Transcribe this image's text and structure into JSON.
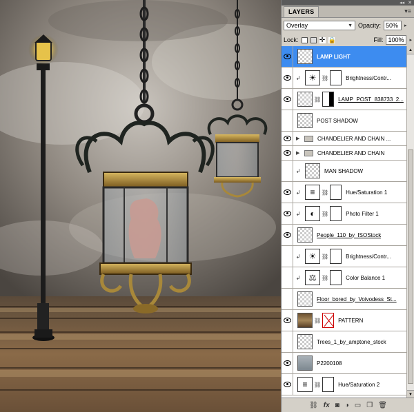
{
  "panel": {
    "title": "LAYERS",
    "blend_mode": "Overlay",
    "opacity_label": "Opacity:",
    "opacity_value": "50%",
    "lock_label": "Lock:",
    "fill_label": "Fill:",
    "fill_value": "100%"
  },
  "layers": [
    {
      "name": "LAMP LIGHT",
      "visible": true,
      "selected": true
    },
    {
      "name": "Brightness/Contr...",
      "visible": true
    },
    {
      "name": "LAMP_POST_838733_2...",
      "visible": true
    },
    {
      "name": "POST SHADOW",
      "visible": false
    },
    {
      "name": "CHANDELIER AND CHAIN ...",
      "visible": true
    },
    {
      "name": "CHANDELIER AND CHAIN",
      "visible": true
    },
    {
      "name": "MAN SHADOW",
      "visible": false
    },
    {
      "name": "Hue/Saturation 1",
      "visible": true
    },
    {
      "name": "Photo Filter 1",
      "visible": true
    },
    {
      "name": "People_110_by_ISOStock",
      "visible": true
    },
    {
      "name": "Brightness/Contr...",
      "visible": false
    },
    {
      "name": "Color Balance 1",
      "visible": false
    },
    {
      "name": "Floor_bored_by_Voivodess_St...",
      "visible": false
    },
    {
      "name": "PATTERN",
      "visible": true
    },
    {
      "name": "Trees_1_by_amptone_stock",
      "visible": false
    },
    {
      "name": "P2200108",
      "visible": true
    },
    {
      "name": "Hue/Saturation 2",
      "visible": true
    }
  ],
  "icons": {
    "link": "link-layers-icon",
    "fx": "fx",
    "mask": "add-mask-icon",
    "adjustment": "new-adjustment-icon",
    "group": "new-group-icon",
    "new_layer": "new-layer-icon",
    "delete": "trash-icon"
  }
}
